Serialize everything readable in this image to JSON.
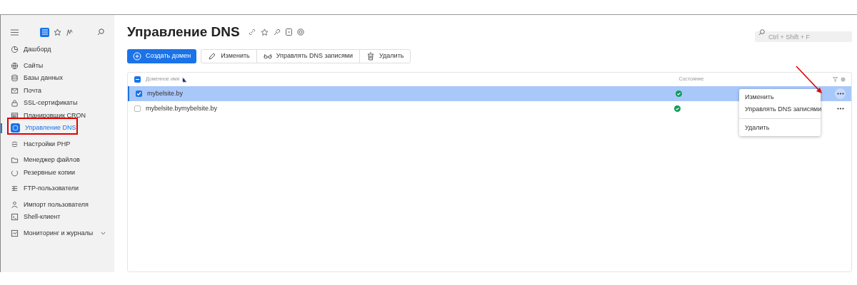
{
  "sidebar": {
    "groups": [
      [
        {
          "label": "Дашборд",
          "selected": false
        }
      ],
      [
        {
          "label": "Сайты",
          "selected": false
        },
        {
          "label": "Базы данных",
          "selected": false
        },
        {
          "label": "Почта",
          "selected": false
        },
        {
          "label": "SSL-сертификаты",
          "selected": false
        },
        {
          "label": "Планировщик CRON",
          "selected": false
        },
        {
          "label": "Управление DNS",
          "selected": true
        }
      ],
      [
        {
          "label": "Настройки PHP",
          "selected": false
        }
      ],
      [
        {
          "label": "Менеджер файлов",
          "selected": false
        },
        {
          "label": "Резервные копии",
          "selected": false
        }
      ],
      [
        {
          "label": "FTP-пользователи",
          "selected": false
        }
      ],
      [
        {
          "label": "Импорт пользователя",
          "selected": false
        },
        {
          "label": "Shell-клиент",
          "selected": false
        }
      ],
      [
        {
          "label": "Мониторинг и журналы",
          "selected": false,
          "expanded": false
        }
      ]
    ]
  },
  "page": {
    "title": "Управление DNS",
    "search": {
      "placeholder": "Ctrl + Shift + F"
    }
  },
  "toolbar": {
    "primary": "Создать домен",
    "buttons": [
      "Изменить",
      "Управлять DNS записями",
      "Удалить"
    ]
  },
  "table": {
    "select_all_partial": true,
    "columns": [
      "Доменное имя",
      "Состояние"
    ],
    "rows": [
      {
        "name": "mybelsite.by",
        "checked": true,
        "ok": true
      },
      {
        "name": "mybelsite.bymybelsite.by",
        "checked": false,
        "ok": true
      }
    ]
  },
  "context_menu": {
    "sections": [
      [
        "Изменить",
        "Управлять DNS записями"
      ],
      [
        "Удалить"
      ]
    ]
  }
}
